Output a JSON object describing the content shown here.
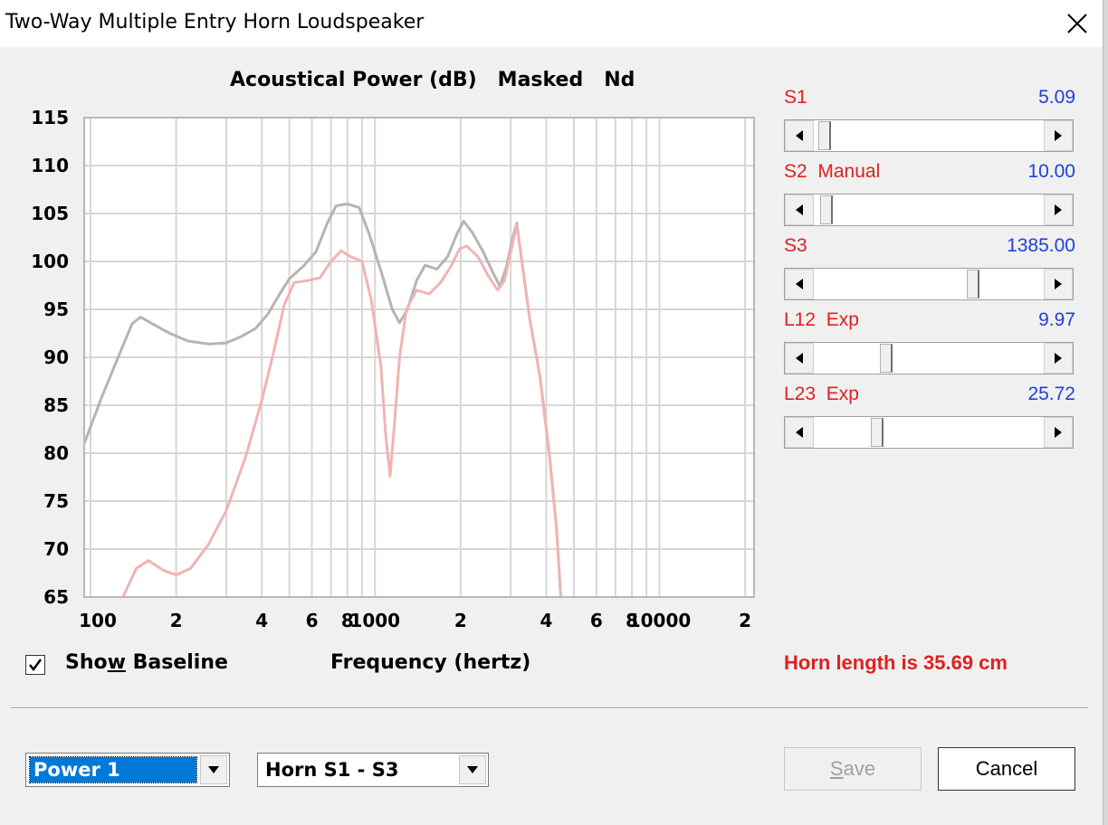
{
  "window": {
    "title": "Two-Way Multiple Entry Horn Loudspeaker"
  },
  "chart_header": {
    "text": "Acoustical Power (dB)   Masked   Nd"
  },
  "chart_data": {
    "type": "line",
    "title": "Acoustical Power (dB)   Masked   Nd",
    "xlabel": "Frequency (hertz)",
    "ylabel": "",
    "xscale": "log",
    "xlim": [
      95,
      21500
    ],
    "ylim": [
      65,
      115
    ],
    "yticks": [
      115,
      110,
      105,
      100,
      95,
      90,
      85,
      80,
      75,
      70,
      65
    ],
    "xticks": [
      {
        "value": 100,
        "label": "100"
      },
      {
        "value": 200,
        "label": "2"
      },
      {
        "value": 400,
        "label": "4"
      },
      {
        "value": 600,
        "label": "6"
      },
      {
        "value": 800,
        "label": "8"
      },
      {
        "value": 1000,
        "label": "1000"
      },
      {
        "value": 2000,
        "label": "2"
      },
      {
        "value": 4000,
        "label": "4"
      },
      {
        "value": 6000,
        "label": "6"
      },
      {
        "value": 8000,
        "label": "8"
      },
      {
        "value": 10000,
        "label": "10000"
      },
      {
        "value": 20000,
        "label": "2"
      }
    ],
    "grid": true,
    "series": [
      {
        "color": "#b4b4b4",
        "points": [
          [
            95,
            81
          ],
          [
            110,
            86
          ],
          [
            125,
            90
          ],
          [
            140,
            93.5
          ],
          [
            150,
            94.2
          ],
          [
            165,
            93.5
          ],
          [
            190,
            92.5
          ],
          [
            220,
            91.7
          ],
          [
            260,
            91.4
          ],
          [
            300,
            91.5
          ],
          [
            340,
            92.2
          ],
          [
            380,
            93
          ],
          [
            420,
            94.5
          ],
          [
            460,
            96.5
          ],
          [
            500,
            98.2
          ],
          [
            560,
            99.5
          ],
          [
            620,
            101
          ],
          [
            680,
            104
          ],
          [
            730,
            105.8
          ],
          [
            800,
            106
          ],
          [
            880,
            105.6
          ],
          [
            950,
            103
          ],
          [
            1050,
            99
          ],
          [
            1150,
            95
          ],
          [
            1220,
            93.6
          ],
          [
            1300,
            95
          ],
          [
            1400,
            98
          ],
          [
            1500,
            99.6
          ],
          [
            1650,
            99.2
          ],
          [
            1800,
            100.5
          ],
          [
            1950,
            103
          ],
          [
            2050,
            104.2
          ],
          [
            2200,
            103
          ],
          [
            2400,
            101
          ],
          [
            2600,
            98.8
          ],
          [
            2750,
            97.4
          ],
          [
            2900,
            99.5
          ],
          [
            3050,
            102.5
          ],
          [
            3150,
            104
          ],
          [
            3250,
            101
          ],
          [
            3500,
            94
          ],
          [
            3800,
            88
          ],
          [
            4100,
            80
          ],
          [
            4350,
            72
          ],
          [
            4500,
            65
          ]
        ]
      },
      {
        "color": "#f0b4b4",
        "points": [
          [
            130,
            65
          ],
          [
            145,
            68
          ],
          [
            160,
            68.8
          ],
          [
            180,
            67.8
          ],
          [
            200,
            67.3
          ],
          [
            225,
            68
          ],
          [
            260,
            70.5
          ],
          [
            300,
            74
          ],
          [
            350,
            79.5
          ],
          [
            400,
            85.5
          ],
          [
            440,
            90.5
          ],
          [
            480,
            95.5
          ],
          [
            520,
            97.8
          ],
          [
            580,
            98
          ],
          [
            640,
            98.3
          ],
          [
            700,
            100
          ],
          [
            760,
            101.1
          ],
          [
            820,
            100.5
          ],
          [
            900,
            100
          ],
          [
            970,
            96
          ],
          [
            1050,
            89
          ],
          [
            1090,
            82
          ],
          [
            1130,
            77.6
          ],
          [
            1170,
            83
          ],
          [
            1220,
            90
          ],
          [
            1290,
            95
          ],
          [
            1400,
            97
          ],
          [
            1550,
            96.6
          ],
          [
            1700,
            97.8
          ],
          [
            1850,
            99.5
          ],
          [
            1980,
            101.3
          ],
          [
            2100,
            101.6
          ],
          [
            2300,
            100.5
          ],
          [
            2500,
            98.5
          ],
          [
            2700,
            97
          ],
          [
            2850,
            98
          ],
          [
            3000,
            101
          ],
          [
            3150,
            103.8
          ],
          [
            3250,
            101
          ],
          [
            3500,
            94
          ],
          [
            3800,
            88
          ],
          [
            4100,
            80
          ],
          [
            4350,
            72
          ],
          [
            4500,
            65
          ]
        ]
      }
    ]
  },
  "sliders": [
    {
      "label": "S1",
      "value": "5.09",
      "position": 0.02
    },
    {
      "label": "S2  Manual",
      "value": "10.00",
      "position": 0.03
    },
    {
      "label": "S3",
      "value": "1385.00",
      "position": 0.7
    },
    {
      "label": "L12  Exp",
      "value": "9.97",
      "position": 0.3
    },
    {
      "label": "L23  Exp",
      "value": "25.72",
      "position": 0.26
    }
  ],
  "horn_length": "Horn length is 35.69 cm",
  "show_baseline": {
    "label_pre": "Sho",
    "label_ul": "w",
    "label_post": " Baseline",
    "checked": true
  },
  "xaxis_label": "Frequency (hertz)",
  "dropdowns": {
    "power": {
      "value": "Power 1"
    },
    "horn": {
      "value": "Horn S1 - S3"
    }
  },
  "buttons": {
    "save": {
      "ul": "S",
      "rest": "ave",
      "disabled": true
    },
    "cancel": {
      "label": "Cancel"
    }
  },
  "colors": {
    "label_red": "#e02020",
    "value_blue": "#2040e0",
    "baseline_gray": "#b4b4b4",
    "masked_pink": "#f0b4b4"
  }
}
